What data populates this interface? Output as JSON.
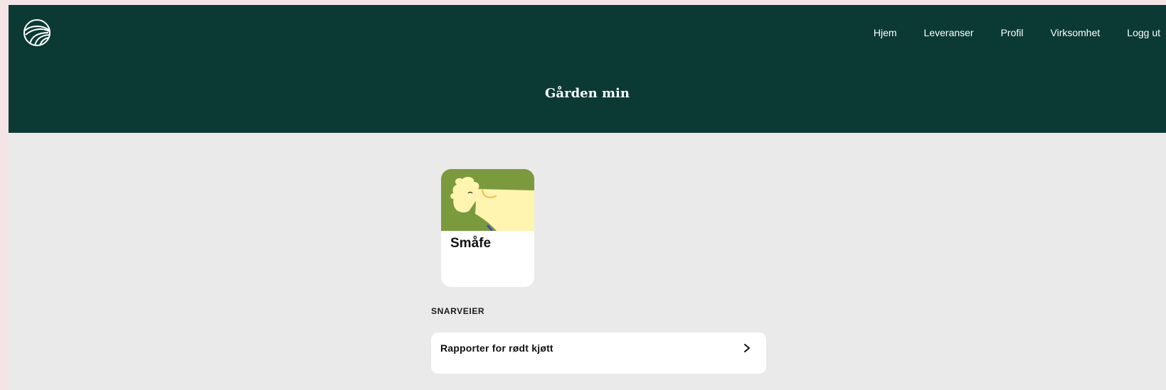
{
  "header": {
    "nav": {
      "items": [
        {
          "label": "Hjem"
        },
        {
          "label": "Leveranser"
        },
        {
          "label": "Profil"
        },
        {
          "label": "Virksomhet"
        },
        {
          "label": "Logg ut"
        }
      ]
    },
    "title": "Gården min",
    "logo_icon": "field-globe-logo-icon"
  },
  "card": {
    "title": "Småfe",
    "image_icon": "sheep-illustration"
  },
  "shortcuts": {
    "heading": "SNARVEIER",
    "items": [
      {
        "label": "Rapporter for rødt kjøtt",
        "icon": "chevron-right-icon"
      }
    ]
  },
  "colors": {
    "header_bg": "#0b3a35",
    "page_bg": "#ebeaea",
    "card_img_green": "#7a9a3e",
    "sheep_yellow": "#fff4b0"
  }
}
